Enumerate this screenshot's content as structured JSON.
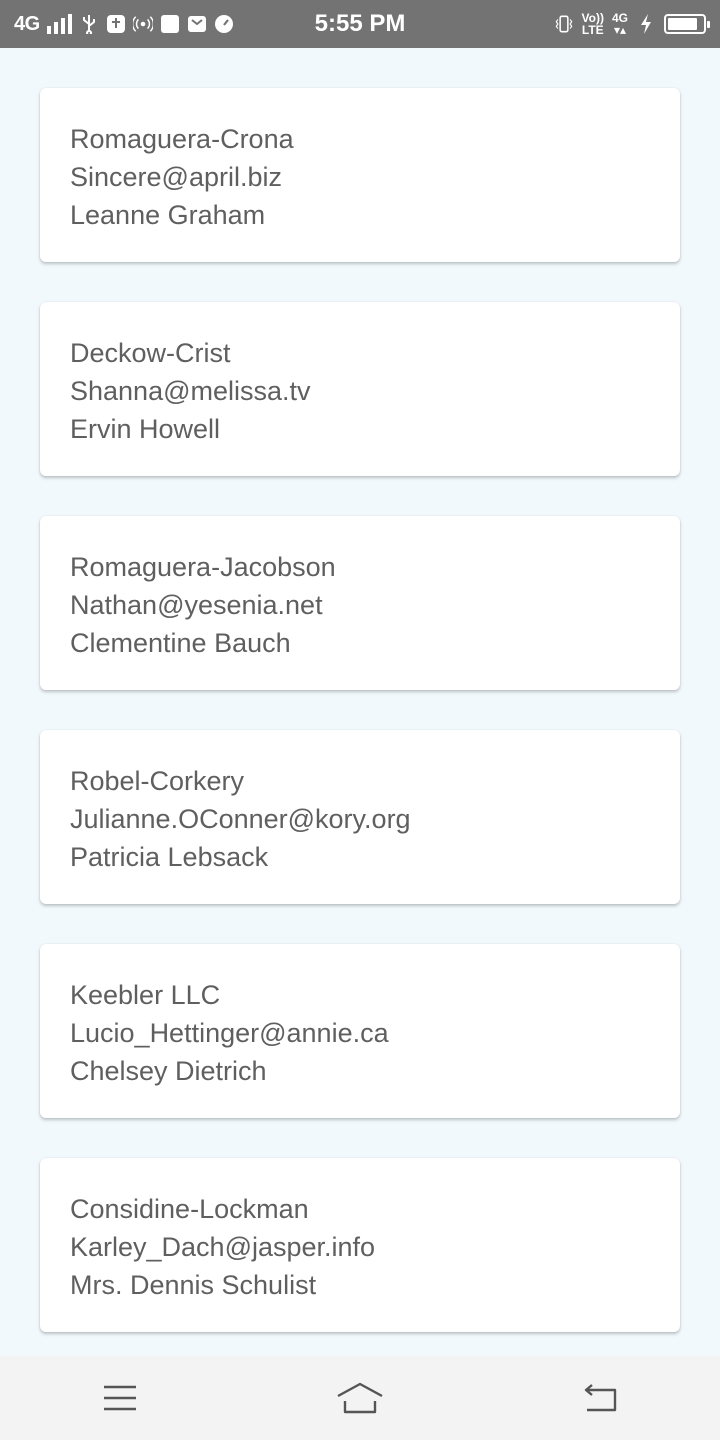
{
  "status_bar": {
    "network": "4G",
    "time": "5:55 PM",
    "volte_top": "Vo))",
    "volte_bottom": "LTE",
    "network_right": "4G",
    "icons": [
      "signal-icon",
      "usb-icon",
      "debug-icon",
      "hotspot-icon",
      "notification-icon",
      "mail-icon",
      "speedometer-icon",
      "vibrate-icon",
      "charging-icon",
      "battery-icon"
    ],
    "battery_level": 0.85
  },
  "users": [
    {
      "company": "Romaguera-Crona",
      "email": "Sincere@april.biz",
      "name": "Leanne Graham"
    },
    {
      "company": "Deckow-Crist",
      "email": "Shanna@melissa.tv",
      "name": "Ervin Howell"
    },
    {
      "company": "Romaguera-Jacobson",
      "email": "Nathan@yesenia.net",
      "name": "Clementine Bauch"
    },
    {
      "company": "Robel-Corkery",
      "email": "Julianne.OConner@kory.org",
      "name": "Patricia Lebsack"
    },
    {
      "company": "Keebler LLC",
      "email": "Lucio_Hettinger@annie.ca",
      "name": "Chelsey Dietrich"
    },
    {
      "company": "Considine-Lockman",
      "email": "Karley_Dach@jasper.info",
      "name": "Mrs. Dennis Schulist"
    }
  ],
  "nav_bar": {
    "buttons": [
      "menu-icon",
      "home-icon",
      "back-icon"
    ]
  },
  "colors": {
    "background": "#f1f9fd",
    "card": "#ffffff",
    "text": "#5f5f5f",
    "status_bar": "#737373",
    "nav_bar": "#f3f3f3"
  }
}
